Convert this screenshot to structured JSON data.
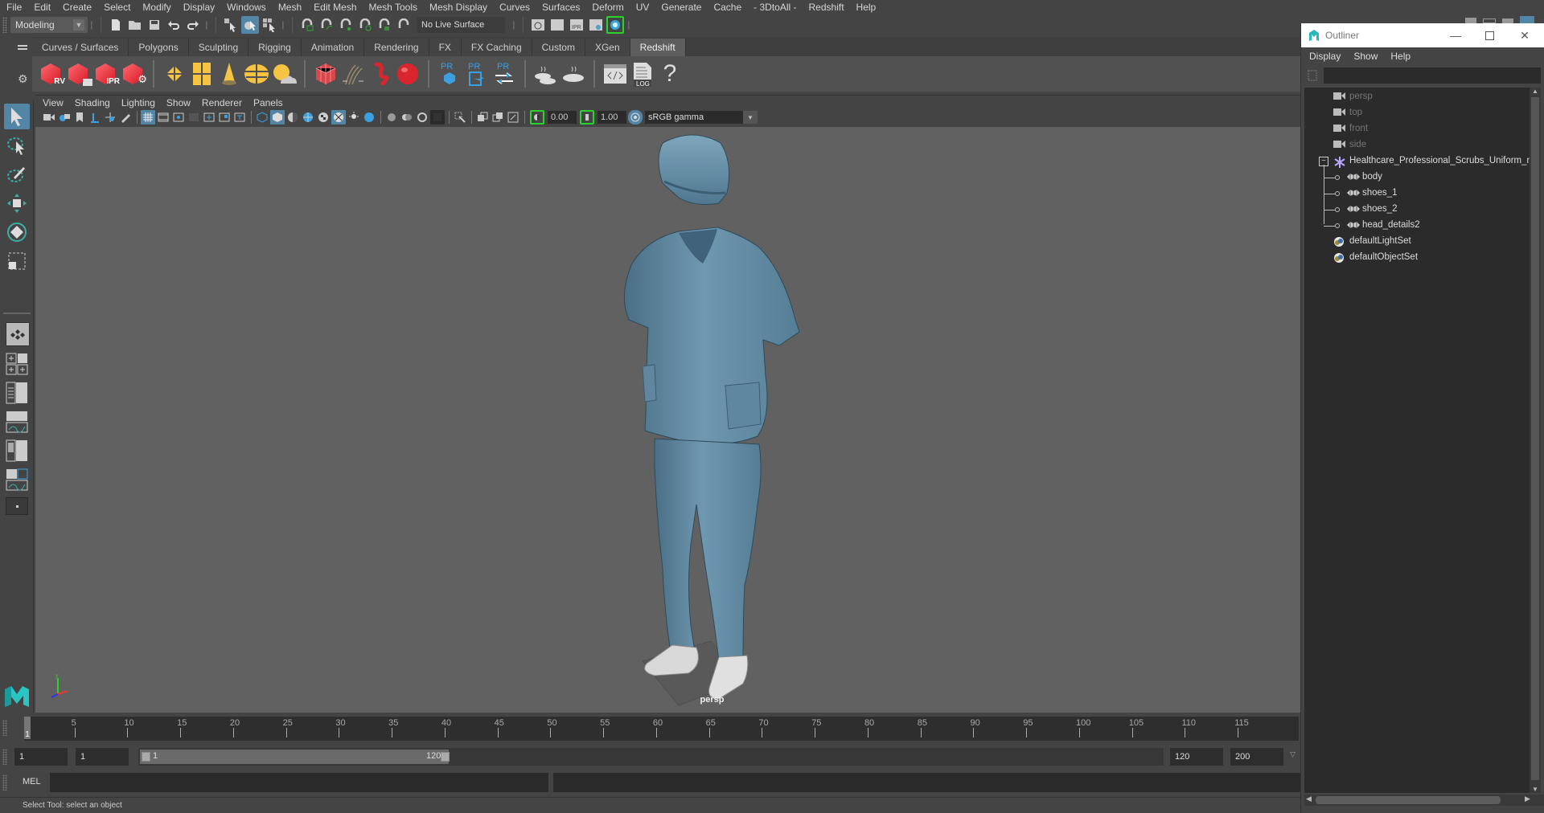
{
  "menubar": {
    "items": [
      "File",
      "Edit",
      "Create",
      "Select",
      "Modify",
      "Display",
      "Windows",
      "Mesh",
      "Edit Mesh",
      "Mesh Tools",
      "Mesh Display",
      "Curves",
      "Surfaces",
      "Deform",
      "UV",
      "Generate",
      "Cache",
      "- 3DtoAll -",
      "Redshift",
      "Help"
    ]
  },
  "statusline": {
    "mode": "Modeling",
    "live_surface": "No Live Surface"
  },
  "shelf": {
    "tabs": [
      "Curves / Surfaces",
      "Polygons",
      "Sculpting",
      "Rigging",
      "Animation",
      "Rendering",
      "FX",
      "FX Caching",
      "Custom",
      "XGen",
      "Redshift"
    ],
    "active_tab": "Redshift",
    "icons": [
      {
        "name": "render-view",
        "label": "RV"
      },
      {
        "name": "render-sequence",
        "label": ""
      },
      {
        "name": "ipr-render",
        "label": "IPR"
      },
      {
        "name": "render-settings",
        "label": ""
      },
      {
        "name": "rs-light-rect",
        "label": ""
      },
      {
        "name": "rs-light-portal",
        "label": ""
      },
      {
        "name": "rs-light-spot",
        "label": ""
      },
      {
        "name": "rs-dome-light",
        "label": ""
      },
      {
        "name": "rs-sun-sky",
        "label": ""
      },
      {
        "name": "rs-proxy",
        "label": ""
      },
      {
        "name": "rs-hair",
        "label": ""
      },
      {
        "name": "rs-volume",
        "label": ""
      },
      {
        "name": "rs-sphere",
        "label": ""
      },
      {
        "name": "pr-create",
        "label": "PR"
      },
      {
        "name": "pr-export",
        "label": "PR"
      },
      {
        "name": "pr-convert",
        "label": "PR"
      },
      {
        "name": "bake-multiple",
        "label": ""
      },
      {
        "name": "bake-single",
        "label": ""
      },
      {
        "name": "shader-editor",
        "label": ""
      },
      {
        "name": "log",
        "label": "LOG"
      },
      {
        "name": "help",
        "label": "?"
      }
    ]
  },
  "panel": {
    "menu": [
      "View",
      "Shading",
      "Lighting",
      "Show",
      "Renderer",
      "Panels"
    ],
    "exposure": "0.00",
    "gamma": "1.00",
    "color_space": "sRGB gamma",
    "camera_label": "persp"
  },
  "timeline": {
    "current_frame": "1",
    "ticks": [
      5,
      10,
      15,
      20,
      25,
      30,
      35,
      40,
      45,
      50,
      55,
      60,
      65,
      70,
      75,
      80,
      85,
      90,
      95,
      100,
      105,
      110,
      115
    ],
    "range_min": 1,
    "range_max": 120,
    "start_field": "1",
    "playback_start": "1",
    "slider_start": "1",
    "slider_end": "120",
    "playback_end": "120",
    "end_field": "200"
  },
  "command_line": {
    "label": "MEL",
    "value": ""
  },
  "help_line": "Select Tool: select an object",
  "outliner": {
    "title": "Outliner",
    "menu": [
      "Display",
      "Show",
      "Help"
    ],
    "search_value": "",
    "items": [
      {
        "label": "persp",
        "type": "camera",
        "dim": true,
        "indent": 0
      },
      {
        "label": "top",
        "type": "camera",
        "dim": true,
        "indent": 0
      },
      {
        "label": "front",
        "type": "camera",
        "dim": true,
        "indent": 0
      },
      {
        "label": "side",
        "type": "camera",
        "dim": true,
        "indent": 0
      },
      {
        "label": "Healthcare_Professional_Scrubs_Uniform_n",
        "type": "group",
        "dim": false,
        "indent": 0,
        "expanded": true
      },
      {
        "label": "body",
        "type": "mesh",
        "dim": false,
        "indent": 1
      },
      {
        "label": "shoes_1",
        "type": "mesh",
        "dim": false,
        "indent": 1
      },
      {
        "label": "shoes_2",
        "type": "mesh",
        "dim": false,
        "indent": 1
      },
      {
        "label": "head_details2",
        "type": "mesh",
        "dim": false,
        "indent": 1
      },
      {
        "label": "defaultLightSet",
        "type": "set",
        "dim": false,
        "indent": 0
      },
      {
        "label": "defaultObjectSet",
        "type": "set",
        "dim": false,
        "indent": 0
      }
    ]
  },
  "colors": {
    "accent": "#5285a6",
    "uniform": "#6d94ac",
    "viewport_bg": "#616161"
  }
}
